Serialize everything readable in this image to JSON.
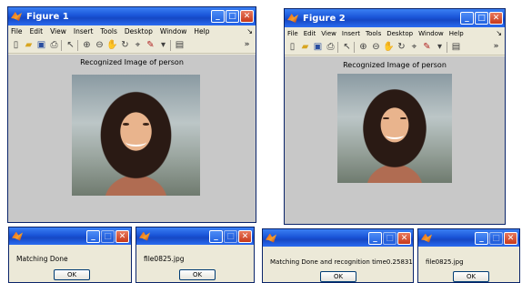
{
  "figure1": {
    "title": "Figure 1",
    "menu": [
      "File",
      "Edit",
      "View",
      "Insert",
      "Tools",
      "Desktop",
      "Window",
      "Help"
    ],
    "plot_title": "Recognized Image of person"
  },
  "figure2": {
    "title": "Figure 2",
    "menu": [
      "File",
      "Edit",
      "View",
      "Insert",
      "Tools",
      "Desktop",
      "Window",
      "Help"
    ],
    "plot_title": "Recognized Image of person"
  },
  "dialogs": [
    {
      "message": "Matching Done",
      "ok_label": "OK"
    },
    {
      "message": "file0825.jpg",
      "ok_label": "OK"
    },
    {
      "message": "Matching Done and recognition time0.25831",
      "ok_label": "OK"
    },
    {
      "message": "file0825.jpg",
      "ok_label": "OK"
    }
  ],
  "icons": {
    "toolbar": [
      "new-file-icon",
      "open-folder-icon",
      "save-icon",
      "print-icon",
      "pointer-icon",
      "zoom-in-icon",
      "zoom-out-icon",
      "pan-icon",
      "rotate-icon",
      "data-cursor-icon",
      "brush-icon",
      "insert-colorbar-icon"
    ],
    "window_controls": [
      "minimize-icon",
      "maximize-icon",
      "close-icon"
    ]
  },
  "colors": {
    "titlebar": "#1a55d8",
    "close_button": "#c7391b",
    "figure_background": "#c8c8c8",
    "window_face": "#ece9d8"
  }
}
